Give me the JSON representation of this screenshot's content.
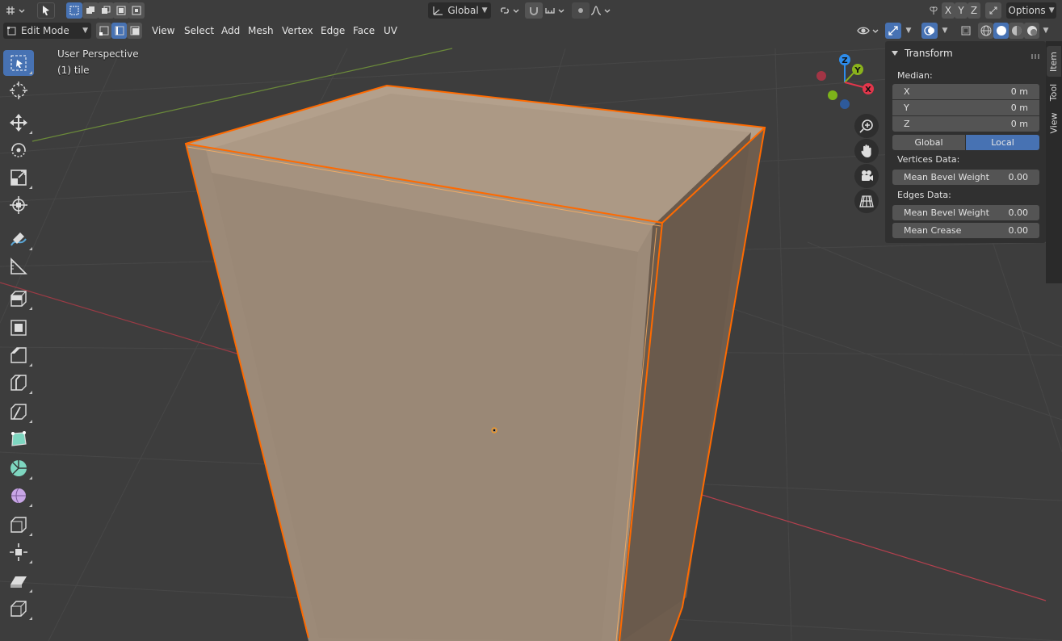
{
  "header_top": {
    "orientation_label": "Global",
    "axis_x": "X",
    "axis_y": "Y",
    "axis_z": "Z",
    "options_label": "Options"
  },
  "header_mode": {
    "mode_label": "Edit Mode",
    "menus": [
      "View",
      "Select",
      "Add",
      "Mesh",
      "Vertex",
      "Edge",
      "Face",
      "UV"
    ]
  },
  "viewport": {
    "perspective_label": "User Perspective",
    "object_label": "(1) tile"
  },
  "gizmo": {
    "x_label": "X",
    "y_label": "Y",
    "z_label": "Z",
    "colors": {
      "x": "#e2364b",
      "y": "#8ab21c",
      "z": "#2d8ceb"
    }
  },
  "sidebar": {
    "panel_title": "Transform",
    "median_label": "Median:",
    "median": [
      {
        "axis": "X",
        "value": "0 m"
      },
      {
        "axis": "Y",
        "value": "0 m"
      },
      {
        "axis": "Z",
        "value": "0 m"
      }
    ],
    "space_global": "Global",
    "space_local": "Local",
    "vertices_data_label": "Vertices Data:",
    "vertex_bevel": {
      "label": "Mean Bevel Weight",
      "value": "0.00"
    },
    "edges_data_label": "Edges Data:",
    "edge_bevel": {
      "label": "Mean Bevel Weight",
      "value": "0.00"
    },
    "edge_crease": {
      "label": "Mean Crease",
      "value": "0.00"
    },
    "tabs": [
      "Item",
      "Tool",
      "View"
    ]
  },
  "theme": {
    "selection_orange": "#ff6a00",
    "accent_blue": "#4772b3",
    "mesh_face": "#9c8a78"
  }
}
